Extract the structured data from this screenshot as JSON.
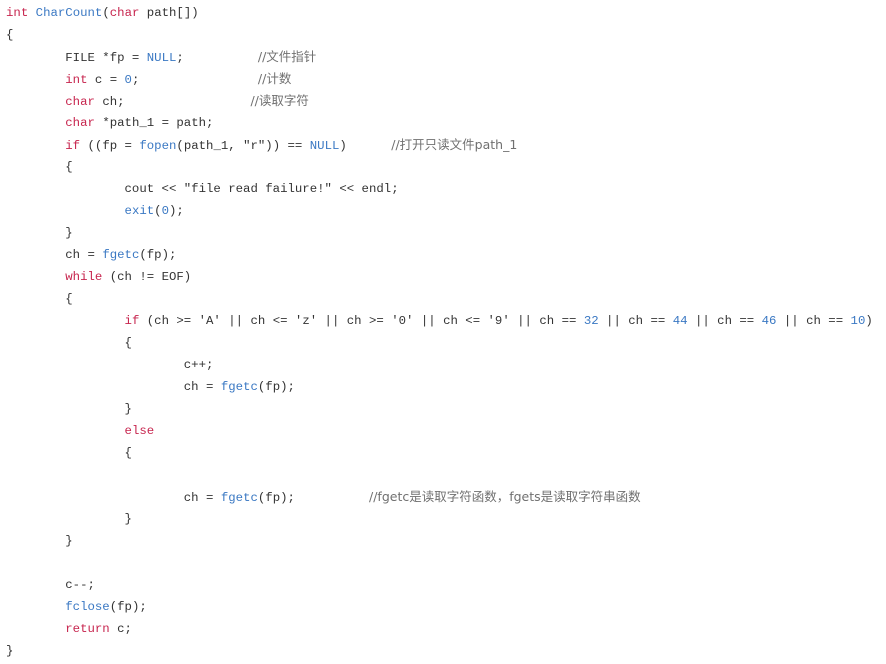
{
  "colors": {
    "keyword": "#c7254e",
    "function": "#3a78c3",
    "number": "#3a78c3",
    "comment": "#707070",
    "plain": "#333333"
  },
  "code_lines": [
    [
      [
        "k",
        "int"
      ],
      [
        "p",
        " "
      ],
      [
        "f",
        "CharCount"
      ],
      [
        "p",
        "("
      ],
      [
        "k",
        "char"
      ],
      [
        "p",
        " path[])"
      ]
    ],
    [
      [
        "p",
        "{"
      ]
    ],
    [
      [
        "p",
        "        FILE *fp = "
      ],
      [
        "n",
        "NULL"
      ],
      [
        "p",
        ";          "
      ],
      [
        "c",
        "//文件指针"
      ]
    ],
    [
      [
        "p",
        "        "
      ],
      [
        "k",
        "int"
      ],
      [
        "p",
        " c = "
      ],
      [
        "n",
        "0"
      ],
      [
        "p",
        ";                "
      ],
      [
        "c",
        "//计数"
      ]
    ],
    [
      [
        "p",
        "        "
      ],
      [
        "k",
        "char"
      ],
      [
        "p",
        " ch;                 "
      ],
      [
        "c",
        "//读取字符"
      ]
    ],
    [
      [
        "p",
        "        "
      ],
      [
        "k",
        "char"
      ],
      [
        "p",
        " *path_1 = path;"
      ]
    ],
    [
      [
        "p",
        "        "
      ],
      [
        "k",
        "if"
      ],
      [
        "p",
        " ((fp = "
      ],
      [
        "f",
        "fopen"
      ],
      [
        "p",
        "(path_1, \"r\")) == "
      ],
      [
        "n",
        "NULL"
      ],
      [
        "p",
        ")      "
      ],
      [
        "c",
        "//打开只读文件path_1"
      ]
    ],
    [
      [
        "p",
        "        {"
      ]
    ],
    [
      [
        "p",
        "                cout << \"file read failure!\" << endl;"
      ]
    ],
    [
      [
        "p",
        "                "
      ],
      [
        "f",
        "exit"
      ],
      [
        "p",
        "("
      ],
      [
        "n",
        "0"
      ],
      [
        "p",
        ");"
      ]
    ],
    [
      [
        "p",
        "        }"
      ]
    ],
    [
      [
        "p",
        "        ch = "
      ],
      [
        "f",
        "fgetc"
      ],
      [
        "p",
        "(fp);"
      ]
    ],
    [
      [
        "p",
        "        "
      ],
      [
        "k",
        "while"
      ],
      [
        "p",
        " (ch != EOF)"
      ]
    ],
    [
      [
        "p",
        "        {"
      ]
    ],
    [
      [
        "p",
        "                "
      ],
      [
        "k",
        "if"
      ],
      [
        "p",
        " (ch >= 'A' || ch <= 'z' || ch >= '0' || ch <= '9' || ch == "
      ],
      [
        "n",
        "32"
      ],
      [
        "p",
        " || ch == "
      ],
      [
        "n",
        "44"
      ],
      [
        "p",
        " || ch == "
      ],
      [
        "n",
        "46"
      ],
      [
        "p",
        " || ch == "
      ],
      [
        "n",
        "10"
      ],
      [
        "p",
        ")"
      ]
    ],
    [
      [
        "p",
        "                {"
      ]
    ],
    [
      [
        "p",
        "                        c++;"
      ]
    ],
    [
      [
        "p",
        "                        ch = "
      ],
      [
        "f",
        "fgetc"
      ],
      [
        "p",
        "(fp);"
      ]
    ],
    [
      [
        "p",
        "                }"
      ]
    ],
    [
      [
        "p",
        "                "
      ],
      [
        "k",
        "else"
      ]
    ],
    [
      [
        "p",
        "                {"
      ]
    ],
    [
      [
        "p",
        ""
      ]
    ],
    [
      [
        "p",
        "                        ch = "
      ],
      [
        "f",
        "fgetc"
      ],
      [
        "p",
        "(fp);          "
      ],
      [
        "c",
        "//fgetc是读取字符函数，fgets是读取字符串函数"
      ]
    ],
    [
      [
        "p",
        "                }"
      ]
    ],
    [
      [
        "p",
        "        }"
      ]
    ],
    [
      [
        "p",
        ""
      ]
    ],
    [
      [
        "p",
        "        c--;"
      ]
    ],
    [
      [
        "p",
        "        "
      ],
      [
        "f",
        "fclose"
      ],
      [
        "p",
        "(fp);"
      ]
    ],
    [
      [
        "p",
        "        "
      ],
      [
        "k",
        "return"
      ],
      [
        "p",
        " c;"
      ]
    ],
    [
      [
        "p",
        "}"
      ]
    ]
  ]
}
